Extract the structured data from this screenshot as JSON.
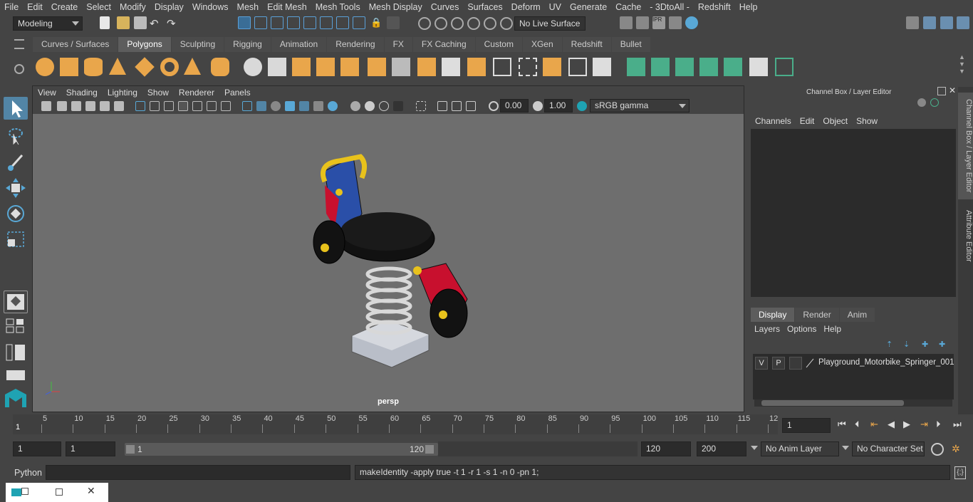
{
  "menubar": {
    "items": [
      "File",
      "Edit",
      "Create",
      "Select",
      "Modify",
      "Display",
      "Windows",
      "Mesh",
      "Edit Mesh",
      "Mesh Tools",
      "Mesh Display",
      "Curves",
      "Surfaces",
      "Deform",
      "UV",
      "Generate",
      "Cache",
      "- 3DtoAll -",
      "Redshift",
      "Help"
    ]
  },
  "status": {
    "mode": "Modeling",
    "live_surface": "No Live Surface"
  },
  "shelf": {
    "tabs": [
      "Curves / Surfaces",
      "Polygons",
      "Sculpting",
      "Rigging",
      "Animation",
      "Rendering",
      "FX",
      "FX Caching",
      "Custom",
      "XGen",
      "Redshift",
      "Bullet"
    ],
    "active_tab": "Polygons"
  },
  "viewport": {
    "menu": [
      "View",
      "Shading",
      "Lighting",
      "Show",
      "Renderer",
      "Panels"
    ],
    "exposure": "0.00",
    "gamma": "1.00",
    "color_space": "sRGB gamma",
    "camera_label": "persp"
  },
  "channel_box": {
    "title": "Channel Box / Layer Editor",
    "menu": [
      "Channels",
      "Edit",
      "Object",
      "Show"
    ]
  },
  "layer_editor": {
    "tabs": [
      "Display",
      "Render",
      "Anim"
    ],
    "active_tab": "Display",
    "menu": [
      "Layers",
      "Options",
      "Help"
    ],
    "layer": {
      "v": "V",
      "p": "P",
      "name": "Playground_Motorbike_Springer_001"
    }
  },
  "side_tabs": [
    "Channel Box / Layer Editor",
    "Attribute Editor"
  ],
  "timeline": {
    "ticks": [
      "5",
      "10",
      "15",
      "20",
      "25",
      "30",
      "35",
      "40",
      "45",
      "50",
      "55",
      "60",
      "65",
      "70",
      "75",
      "80",
      "85",
      "90",
      "95",
      "100",
      "105",
      "110",
      "115",
      "12"
    ],
    "start_marker": "1",
    "current_frame": "1"
  },
  "range": {
    "start": "1",
    "playback_start": "1",
    "slider_start": "1",
    "slider_end": "120",
    "playback_end": "120",
    "end": "200",
    "anim_layer": "No Anim Layer",
    "character_set": "No Character Set"
  },
  "command": {
    "language": "Python",
    "output": "makeIdentity -apply true -t 1 -r 1 -s 1 -n 0 -pn 1;"
  },
  "colors": {
    "bg": "#444444",
    "viewport": "#6e6e6e",
    "accent": "#5285a6"
  }
}
